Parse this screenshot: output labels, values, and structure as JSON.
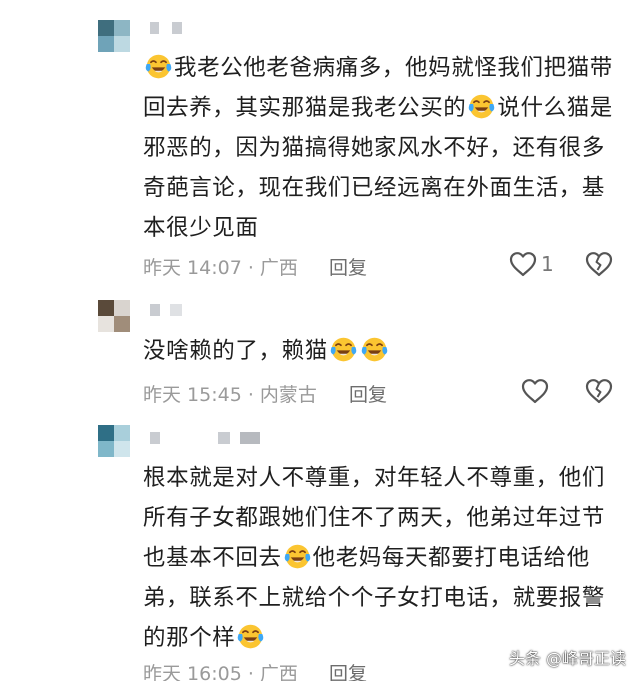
{
  "comments": [
    {
      "segments": [
        {
          "emoji": "laughing-crying-emoji"
        },
        {
          "text": "我老公他老爸病痛多，他妈就怪我们把猫带回去养，其实那猫是我老公买的"
        },
        {
          "emoji": "laughing-crying-emoji"
        },
        {
          "text": "说什么猫是邪恶的，因为猫搞得她家风水不好，还有很多奇葩言论，现在我们已经远离在外面生活，基本很少见面"
        }
      ],
      "time": "昨天 14:07 · 广西",
      "reply_label": "回复",
      "like_count": "1",
      "like_icon": "heart-outline-icon",
      "dislike_icon": "broken-heart-icon"
    },
    {
      "segments": [
        {
          "text": "没啥赖的了，赖猫"
        },
        {
          "emoji": "laughing-crying-emoji"
        },
        {
          "emoji": "laughing-crying-emoji"
        }
      ],
      "time": "昨天 15:45 · 内蒙古",
      "reply_label": "回复",
      "like_count": "",
      "like_icon": "heart-outline-icon",
      "dislike_icon": "broken-heart-icon"
    },
    {
      "segments": [
        {
          "text": "根本就是对人不尊重，对年轻人不尊重，他们所有子女都跟她们住不了两天，他弟过年过节也基本不回去"
        },
        {
          "emoji": "laughing-crying-emoji"
        },
        {
          "text": "他老妈每天都要打电话给他弟，联系不上就给个个子女打电话，就要报警的那个样"
        },
        {
          "emoji": "laughing-crying-emoji"
        }
      ],
      "time": "昨天 16:05 · 广西",
      "reply_label": "回复",
      "like_count": "",
      "like_icon": "heart-outline-icon",
      "dislike_icon": "broken-heart-icon"
    }
  ],
  "watermark": "头条 @峰哥正读",
  "colors": {
    "emoji_face": "#fbc531",
    "emoji_tear": "#3fa8f4",
    "mouth": "#7a3f12",
    "icon_stroke": "#555555"
  }
}
